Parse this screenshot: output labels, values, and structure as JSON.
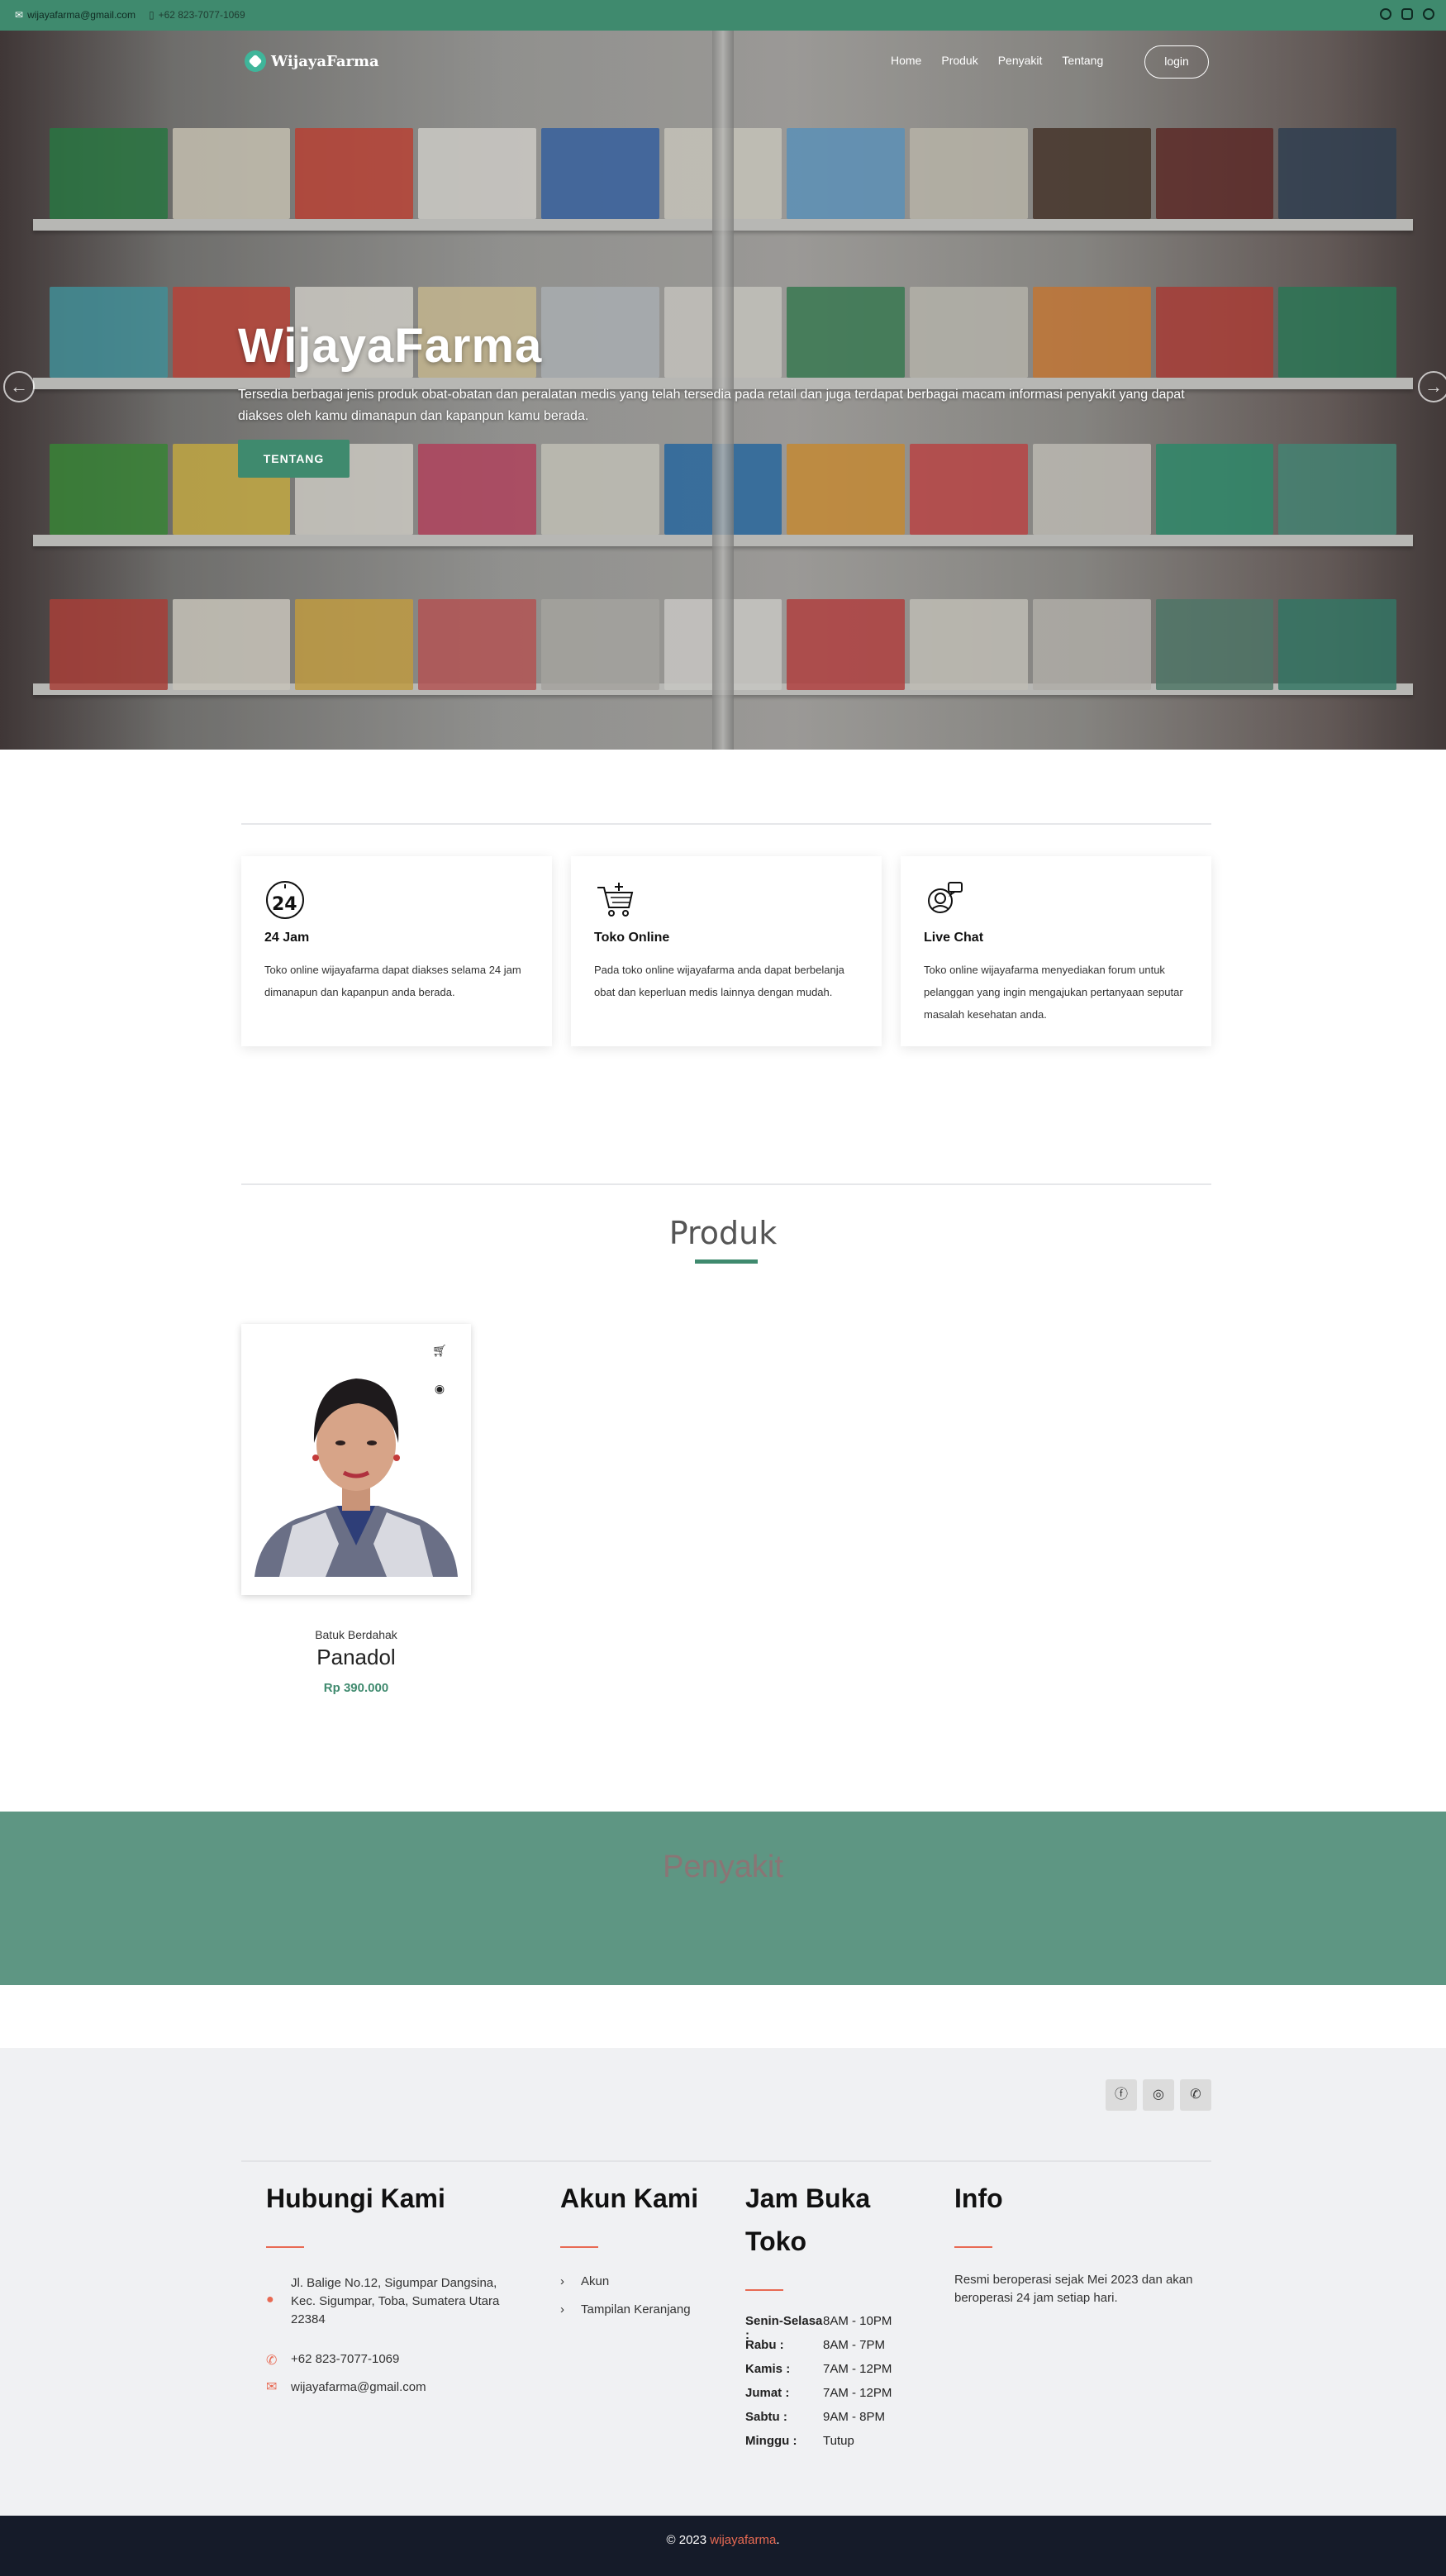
{
  "topbar": {
    "email": "wijayafarma@gmail.com",
    "phone": "+62 823-7077-1069",
    "socials": [
      "facebook-icon",
      "instagram-icon",
      "whatsapp-icon"
    ]
  },
  "nav": {
    "brand": "WijayaFarma",
    "items": [
      "Home",
      "Produk",
      "Penyakit",
      "Tentang"
    ],
    "login": "login"
  },
  "hero": {
    "title": "WijayaFarma",
    "description": "Tersedia berbagai jenis produk obat-obatan dan peralatan medis yang telah tersedia pada retail dan juga terdapat berbagai macam informasi penyakit yang dapat diakses oleh kamu dimanapun dan kapanpun kamu berada.",
    "button": "TENTANG",
    "prev": "←",
    "next": "→"
  },
  "features": [
    {
      "icon": "clock-24-icon",
      "title": "24 Jam",
      "text": "Toko online wijayafarma dapat diakses selama 24 jam dimanapun dan kapanpun anda berada."
    },
    {
      "icon": "shopping-cart-icon",
      "title": "Toko Online",
      "text": "Pada toko online wijayafarma anda dapat berbelanja obat dan keperluan medis lainnya dengan mudah."
    },
    {
      "icon": "live-chat-icon",
      "title": "Live Chat",
      "text": "Toko online wijayafarma menyediakan forum untuk pelanggan yang ingin mengajukan pertanyaan seputar masalah kesehatan anda."
    }
  ],
  "produk": {
    "title": "Produk",
    "items": [
      {
        "category": "Batuk Berdahak",
        "name": "Panadol",
        "price": "Rp 390.000"
      }
    ]
  },
  "penyakit": {
    "title": "Penyakit"
  },
  "footer": {
    "contact": {
      "title": "Hubungi Kami",
      "address": "Jl. Balige No.12, Sigumpar Dangsina, Kec. Sigumpar, Toba, Sumatera Utara 22384",
      "phone": "+62 823-7077-1069",
      "email": "wijayafarma@gmail.com"
    },
    "account": {
      "title": "Akun Kami",
      "links": [
        "Akun",
        "Tampilan Keranjang"
      ]
    },
    "hours": {
      "title": "Jam Buka Toko",
      "rows": [
        {
          "day": "Senin-Selasa :",
          "time": "8AM - 10PM"
        },
        {
          "day": "Rabu :",
          "time": "8AM - 7PM"
        },
        {
          "day": "Kamis :",
          "time": "7AM - 12PM"
        },
        {
          "day": "Jumat :",
          "time": "7AM - 12PM"
        },
        {
          "day": "Sabtu :",
          "time": "9AM - 8PM"
        },
        {
          "day": "Minggu :",
          "time": "Tutup"
        }
      ]
    },
    "info": {
      "title": "Info",
      "text": "Resmi beroperasi sejak Mei 2023 dan akan beroperasi 24 jam setiap hari."
    }
  },
  "copyright": {
    "prefix": "© 2023 ",
    "brand": "wijayafarma",
    "suffix": "."
  },
  "colors": {
    "primary": "#3f8a6e",
    "accent": "#e86a53",
    "dark": "#151b29",
    "footer_bg": "#f0f1f3",
    "penyakit_bg": "#5e9683"
  }
}
